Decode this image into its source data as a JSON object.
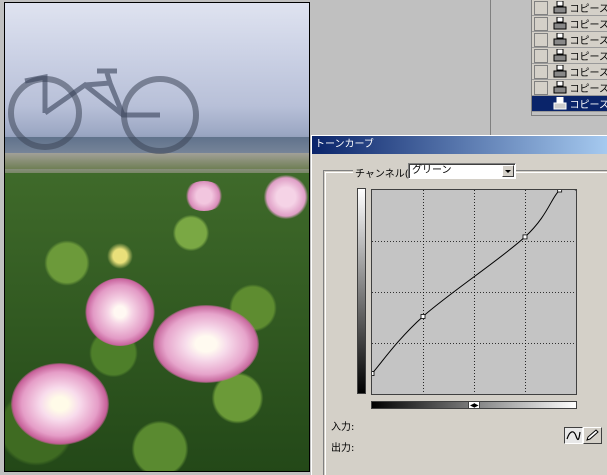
{
  "layers": {
    "items": [
      {
        "name": "コピース"
      },
      {
        "name": "コピース"
      },
      {
        "name": "コピース"
      },
      {
        "name": "コピース"
      },
      {
        "name": "コピース"
      },
      {
        "name": "コピース"
      },
      {
        "name": "コピース",
        "selected": true
      }
    ]
  },
  "dialog": {
    "title": "トーンカーブ",
    "channel_label": "チャンネル(C):",
    "channel_value": "グリーン",
    "input_label": "入力:",
    "output_label": "出力:"
  },
  "curve": {
    "points": [
      [
        0,
        0.1
      ],
      [
        0.25,
        0.38
      ],
      [
        0.75,
        0.77
      ],
      [
        0.92,
        1.0
      ],
      [
        1.0,
        1.0
      ]
    ]
  },
  "colors": {
    "titlebar_start": "#0a246a",
    "titlebar_end": "#a6caf0",
    "selection": "#0a246a",
    "panel": "#d4d0c8"
  },
  "icons": {
    "layer": "stamp-icon",
    "curve_tool": "curve-tool-icon",
    "pencil_tool": "pencil-tool-icon"
  }
}
